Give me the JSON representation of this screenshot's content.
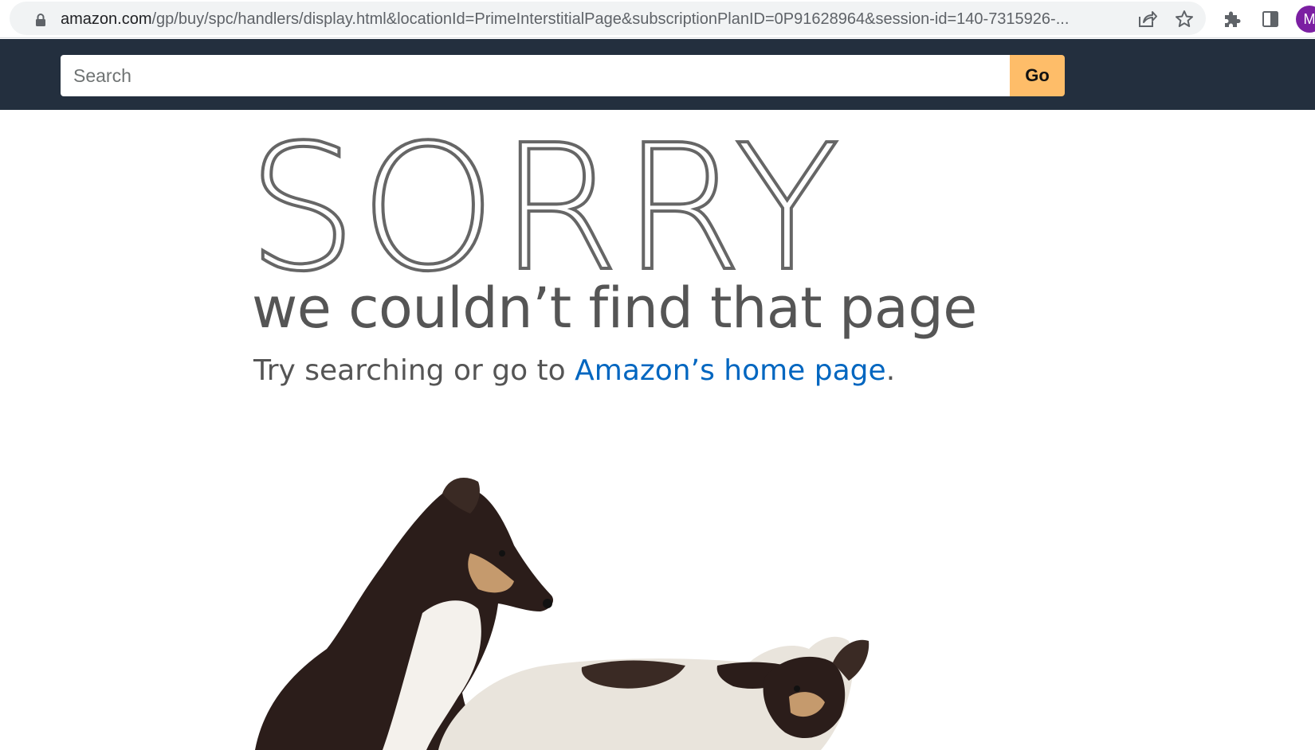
{
  "browser": {
    "url_host": "amazon.com",
    "url_path": "/gp/buy/spc/handlers/display.html&locationId=PrimeInterstitialPage&subscriptionPlanID=0P91628964&session-id=140-7315926-...",
    "avatar_letter": "M",
    "icons": [
      "lock-icon",
      "share-icon",
      "star-icon",
      "extensions-icon",
      "side-panel-icon"
    ]
  },
  "nav": {
    "search_placeholder": "Search",
    "go_label": "Go",
    "background": "#232f3e",
    "button_color": "#febd69"
  },
  "error": {
    "headline": "SORRY",
    "subtitle": "we couldn’t find that page",
    "try_prefix": "Try searching or go to ",
    "home_link": "Amazon’s home page",
    "try_suffix": ".",
    "link_color": "#0066c0"
  }
}
